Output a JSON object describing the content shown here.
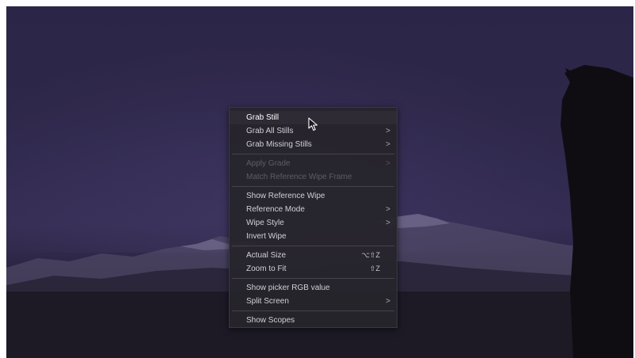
{
  "context_menu": {
    "items": [
      {
        "label": "Grab Still",
        "shortcut": "",
        "submenu": false,
        "disabled": false
      },
      {
        "label": "Grab All Stills",
        "shortcut": "",
        "submenu": true,
        "disabled": false
      },
      {
        "label": "Grab Missing Stills",
        "shortcut": "",
        "submenu": true,
        "disabled": false
      },
      {
        "label": "Apply Grade",
        "shortcut": "",
        "submenu": true,
        "disabled": true
      },
      {
        "label": "Match Reference Wipe Frame",
        "shortcut": "",
        "submenu": false,
        "disabled": true
      },
      {
        "label": "Show Reference Wipe",
        "shortcut": "",
        "submenu": false,
        "disabled": false
      },
      {
        "label": "Reference Mode",
        "shortcut": "",
        "submenu": true,
        "disabled": false
      },
      {
        "label": "Wipe Style",
        "shortcut": "",
        "submenu": true,
        "disabled": false
      },
      {
        "label": "Invert Wipe",
        "shortcut": "",
        "submenu": false,
        "disabled": false
      },
      {
        "label": "Actual Size",
        "shortcut": "⌥⇧Z",
        "submenu": false,
        "disabled": false
      },
      {
        "label": "Zoom to Fit",
        "shortcut": "⇧Z",
        "submenu": false,
        "disabled": false
      },
      {
        "label": "Show picker RGB value",
        "shortcut": "",
        "submenu": false,
        "disabled": false
      },
      {
        "label": "Split Screen",
        "shortcut": "",
        "submenu": true,
        "disabled": false
      },
      {
        "label": "Show Scopes",
        "shortcut": "",
        "submenu": false,
        "disabled": false
      }
    ],
    "submenu_glyph": ">"
  },
  "colors": {
    "menu_bg": "#26242c",
    "menu_text": "#d2d0d6",
    "menu_disabled_text": "#5f5c68",
    "viewer_sky": "#2d2749"
  },
  "icons": {
    "cursor": "arrow-pointer-icon"
  }
}
